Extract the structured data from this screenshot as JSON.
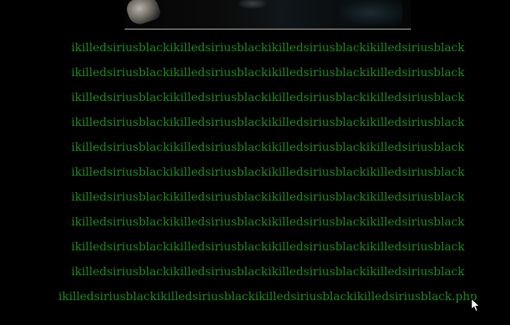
{
  "page": {
    "lines": [
      "ikilledsiriusblackikilledsiriusblackikilledsiriusblackikilledsiriusblack",
      "ikilledsiriusblackikilledsiriusblackikilledsiriusblackikilledsiriusblack",
      "ikilledsiriusblackikilledsiriusblackikilledsiriusblackikilledsiriusblack",
      "ikilledsiriusblackikilledsiriusblackikilledsiriusblackikilledsiriusblack",
      "ikilledsiriusblackikilledsiriusblackikilledsiriusblackikilledsiriusblack",
      "ikilledsiriusblackikilledsiriusblackikilledsiriusblackikilledsiriusblack",
      "ikilledsiriusblackikilledsiriusblackikilledsiriusblackikilledsiriusblack",
      "ikilledsiriusblackikilledsiriusblackikilledsiriusblackikilledsiriusblack",
      "ikilledsiriusblackikilledsiriusblackikilledsiriusblackikilledsiriusblack",
      "ikilledsiriusblackikilledsiriusblackikilledsiriusblackikilledsiriusblack"
    ],
    "link_text": "ikilledsiriusblackikilledsiriusblackikilledsiriusblackikilledsiriusblack.php"
  },
  "colors": {
    "background": "#000000",
    "text": "#1e8b1e",
    "divider": "#6e6e6e"
  },
  "icons": {
    "cursor": "mouse-pointer-icon"
  }
}
